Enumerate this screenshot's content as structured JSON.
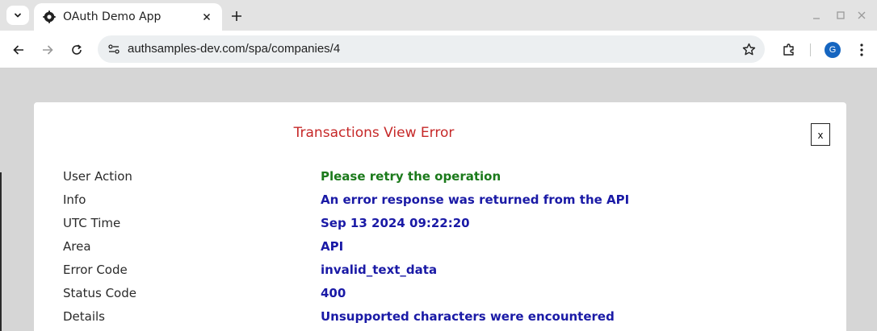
{
  "browser": {
    "tab": {
      "title": "OAuth Demo App",
      "favicon": "oauth-gear-icon"
    },
    "address": {
      "url": "authsamples-dev.com/spa/companies/4"
    },
    "profile_initial": "G"
  },
  "dialog": {
    "title": "Transactions View Error",
    "close_label": "x",
    "rows": [
      {
        "label": "User Action",
        "value": "Please retry the operation"
      },
      {
        "label": "Info",
        "value": "An error response was returned from the API"
      },
      {
        "label": "UTC Time",
        "value": "Sep 13 2024 09:22:20"
      },
      {
        "label": "Area",
        "value": "API"
      },
      {
        "label": "Error Code",
        "value": "invalid_text_data"
      },
      {
        "label": "Status Code",
        "value": "400"
      },
      {
        "label": "Details",
        "value": "Unsupported characters were encountered"
      }
    ]
  },
  "colors": {
    "title": "#c62828",
    "value": "#1a1aa6",
    "user_action_value": "#1b7a1b",
    "page_background": "#d6d6d6"
  }
}
